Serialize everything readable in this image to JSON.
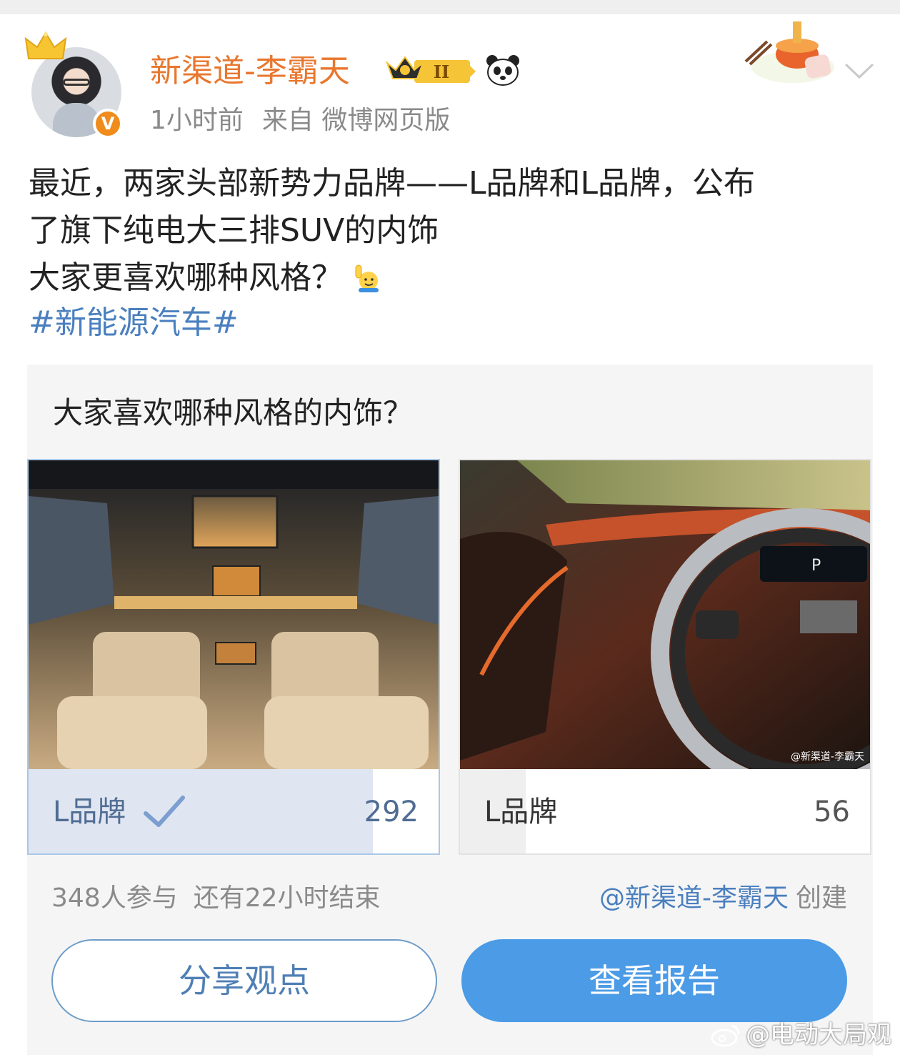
{
  "header": {
    "username": "新渠道-李霸天",
    "level_badge_text": "II",
    "time": "1小时前",
    "source": "来自 微博网页版"
  },
  "post": {
    "lines": [
      "最近，两家头部新势力品牌——L品牌和L品牌，公布",
      "了旗下纯电大三排SUV的内饰",
      "大家更喜欢哪种风格？"
    ],
    "hashtag": "#新能源汽车#"
  },
  "poll": {
    "question": "大家喜欢哪种风格的内饰？",
    "options": [
      {
        "label": "L品牌",
        "count": "292",
        "share": 0.839,
        "selected": true
      },
      {
        "label": "L品牌",
        "count": "56",
        "share": 0.161,
        "selected": false
      }
    ],
    "image_watermark": "@新渠道-李霸天",
    "participants": "348人参与",
    "remaining": "还有22小时结束",
    "creator_mention": "@新渠道-李霸天",
    "creator_suffix": "创建",
    "share_button": "分享观点",
    "report_button": "查看报告"
  },
  "watermark": "@电动大局观",
  "colors": {
    "username": "#e8772e",
    "link": "#4a7fbf",
    "primary_button": "#4b9be6",
    "selected_bar": "#dfe6f1"
  }
}
